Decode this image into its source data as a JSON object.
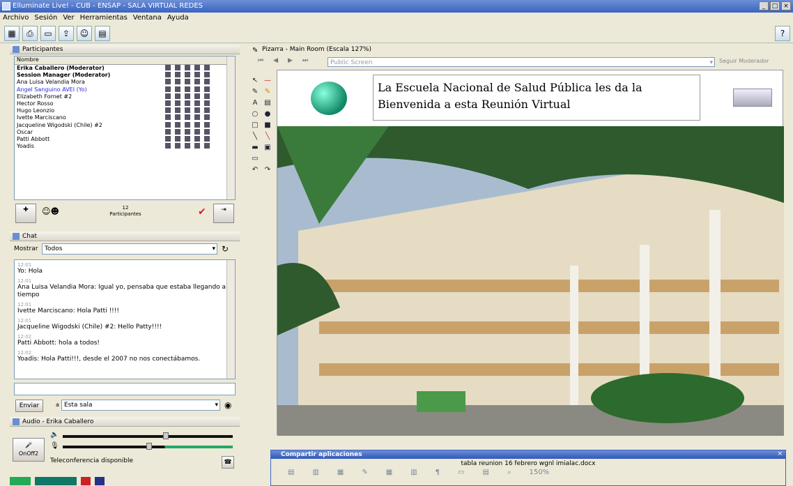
{
  "window": {
    "title": "Elluminate Live! - CUB - ENSAP - SALA VIRTUAL REDES"
  },
  "menu": [
    "Archivo",
    "Sesión",
    "Ver",
    "Herramientas",
    "Ventana",
    "Ayuda"
  ],
  "participants": {
    "title": "Participantes",
    "column": "Nombre",
    "list": [
      {
        "name": "Erika Caballero (Moderator)",
        "role": "mod"
      },
      {
        "name": "Session Manager (Moderator)",
        "role": "mod"
      },
      {
        "name": "Ana Luisa Velandia Mora",
        "role": ""
      },
      {
        "name": "Angel Sanguino AVEI (Yo)",
        "role": "me"
      },
      {
        "name": "Elizabeth Fornet #2",
        "role": ""
      },
      {
        "name": "Hector Rosso",
        "role": ""
      },
      {
        "name": "Hugo Leonzio",
        "role": ""
      },
      {
        "name": "Ivette Marciscano",
        "role": ""
      },
      {
        "name": "Jacqueline Wigodski (Chile) #2",
        "role": ""
      },
      {
        "name": "Oscar",
        "role": ""
      },
      {
        "name": "Patti Abbott",
        "role": ""
      },
      {
        "name": "Yoadis",
        "role": ""
      }
    ],
    "count": "12",
    "count_label": "Participantes"
  },
  "chat": {
    "title": "Chat",
    "show_label": "Mostrar",
    "show_value": "Todos",
    "messages": [
      {
        "time": "12:01",
        "text": "Yo: Hola"
      },
      {
        "time": "12:01",
        "text": "Ana Luisa Velandia Mora: Igual yo, pensaba que estaba llegando a tiempo"
      },
      {
        "time": "12:01",
        "text": "Ivette Marciscano: Hola Patti !!!!"
      },
      {
        "time": "12:01",
        "text": "Jacqueline Wigodski (Chile) #2: Hello Patty!!!!"
      },
      {
        "time": "12:02",
        "text": "Patti Abbott: hola a todos!"
      },
      {
        "time": "12:02",
        "text": "Yoadis: Hola Patti!!!, desde el 2007 no nos conectábamos."
      }
    ],
    "send_label": "Enviar",
    "to_label": "a",
    "to_value": "Esta sala"
  },
  "audio": {
    "title": "Audio - Erika Caballero",
    "button": "OnOff2",
    "status": "Teleconferencia disponible"
  },
  "whiteboard": {
    "title": "Pizarra - Main Room (Escala 127%)",
    "screen": "Public Screen",
    "follow": "Seguir Moderador",
    "welcome": "La Escuela Nacional de Salud Pública les da la Bienvenida a esta Reunión Virtual"
  },
  "share": {
    "title": "Compartir aplicaciones",
    "doc": "tabla reunion 16 febrero wgnl imialac.docx",
    "zoom": "150%"
  }
}
